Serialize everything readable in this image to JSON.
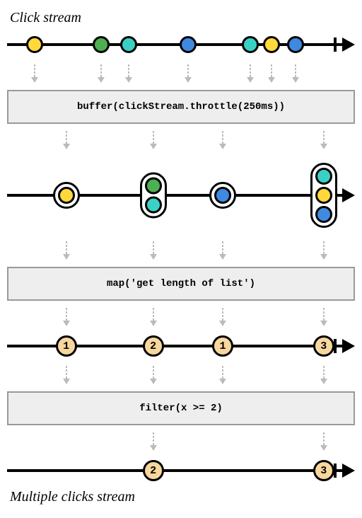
{
  "titles": {
    "top": "Click stream",
    "bottom": "Multiple clicks stream"
  },
  "operators": {
    "buffer": "buffer(clickStream.throttle(250ms))",
    "map": "map('get length of list')",
    "filter": "filter(x >= 2)"
  },
  "sourceEvents": [
    {
      "pos": 8,
      "color": "yellow"
    },
    {
      "pos": 27,
      "color": "green"
    },
    {
      "pos": 35,
      "color": "cyan"
    },
    {
      "pos": 52,
      "color": "blue"
    },
    {
      "pos": 70,
      "color": "cyan"
    },
    {
      "pos": 76,
      "color": "yellow"
    },
    {
      "pos": 83,
      "color": "blue"
    }
  ],
  "sourceArrowPositions": [
    8,
    27,
    35,
    52,
    70,
    76,
    83
  ],
  "bufferedGroups": [
    {
      "pos": 17,
      "items": [
        "yellow"
      ]
    },
    {
      "pos": 42,
      "items": [
        "green",
        "cyan"
      ]
    },
    {
      "pos": 62,
      "items": [
        "blue"
      ]
    },
    {
      "pos": 91,
      "items": [
        "cyan",
        "yellow",
        "blue"
      ]
    }
  ],
  "groupArrowPositions": [
    17,
    42,
    62,
    91
  ],
  "counts": [
    {
      "pos": 17,
      "value": "1"
    },
    {
      "pos": 42,
      "value": "2"
    },
    {
      "pos": 62,
      "value": "1"
    },
    {
      "pos": 91,
      "value": "3"
    }
  ],
  "filtered": [
    {
      "pos": 42,
      "value": "2"
    },
    {
      "pos": 91,
      "value": "3"
    }
  ],
  "filteredArrowPositions": [
    42,
    91
  ]
}
